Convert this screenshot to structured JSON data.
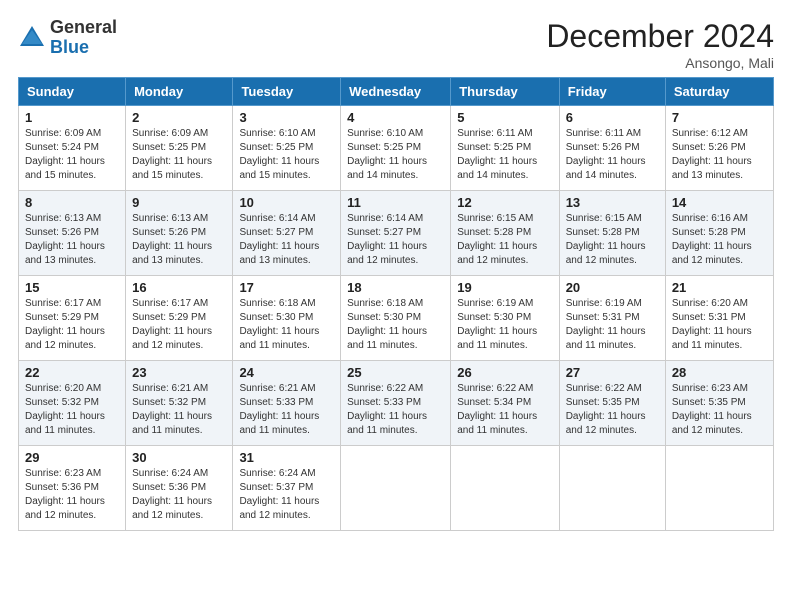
{
  "logo": {
    "general": "General",
    "blue": "Blue"
  },
  "title": "December 2024",
  "location": "Ansongo, Mali",
  "days_header": [
    "Sunday",
    "Monday",
    "Tuesday",
    "Wednesday",
    "Thursday",
    "Friday",
    "Saturday"
  ],
  "weeks": [
    [
      {
        "day": "1",
        "sunrise": "6:09 AM",
        "sunset": "5:24 PM",
        "daylight": "11 hours and 15 minutes."
      },
      {
        "day": "2",
        "sunrise": "6:09 AM",
        "sunset": "5:25 PM",
        "daylight": "11 hours and 15 minutes."
      },
      {
        "day": "3",
        "sunrise": "6:10 AM",
        "sunset": "5:25 PM",
        "daylight": "11 hours and 15 minutes."
      },
      {
        "day": "4",
        "sunrise": "6:10 AM",
        "sunset": "5:25 PM",
        "daylight": "11 hours and 14 minutes."
      },
      {
        "day": "5",
        "sunrise": "6:11 AM",
        "sunset": "5:25 PM",
        "daylight": "11 hours and 14 minutes."
      },
      {
        "day": "6",
        "sunrise": "6:11 AM",
        "sunset": "5:26 PM",
        "daylight": "11 hours and 14 minutes."
      },
      {
        "day": "7",
        "sunrise": "6:12 AM",
        "sunset": "5:26 PM",
        "daylight": "11 hours and 13 minutes."
      }
    ],
    [
      {
        "day": "8",
        "sunrise": "6:13 AM",
        "sunset": "5:26 PM",
        "daylight": "11 hours and 13 minutes."
      },
      {
        "day": "9",
        "sunrise": "6:13 AM",
        "sunset": "5:26 PM",
        "daylight": "11 hours and 13 minutes."
      },
      {
        "day": "10",
        "sunrise": "6:14 AM",
        "sunset": "5:27 PM",
        "daylight": "11 hours and 13 minutes."
      },
      {
        "day": "11",
        "sunrise": "6:14 AM",
        "sunset": "5:27 PM",
        "daylight": "11 hours and 12 minutes."
      },
      {
        "day": "12",
        "sunrise": "6:15 AM",
        "sunset": "5:28 PM",
        "daylight": "11 hours and 12 minutes."
      },
      {
        "day": "13",
        "sunrise": "6:15 AM",
        "sunset": "5:28 PM",
        "daylight": "11 hours and 12 minutes."
      },
      {
        "day": "14",
        "sunrise": "6:16 AM",
        "sunset": "5:28 PM",
        "daylight": "11 hours and 12 minutes."
      }
    ],
    [
      {
        "day": "15",
        "sunrise": "6:17 AM",
        "sunset": "5:29 PM",
        "daylight": "11 hours and 12 minutes."
      },
      {
        "day": "16",
        "sunrise": "6:17 AM",
        "sunset": "5:29 PM",
        "daylight": "11 hours and 12 minutes."
      },
      {
        "day": "17",
        "sunrise": "6:18 AM",
        "sunset": "5:30 PM",
        "daylight": "11 hours and 11 minutes."
      },
      {
        "day": "18",
        "sunrise": "6:18 AM",
        "sunset": "5:30 PM",
        "daylight": "11 hours and 11 minutes."
      },
      {
        "day": "19",
        "sunrise": "6:19 AM",
        "sunset": "5:30 PM",
        "daylight": "11 hours and 11 minutes."
      },
      {
        "day": "20",
        "sunrise": "6:19 AM",
        "sunset": "5:31 PM",
        "daylight": "11 hours and 11 minutes."
      },
      {
        "day": "21",
        "sunrise": "6:20 AM",
        "sunset": "5:31 PM",
        "daylight": "11 hours and 11 minutes."
      }
    ],
    [
      {
        "day": "22",
        "sunrise": "6:20 AM",
        "sunset": "5:32 PM",
        "daylight": "11 hours and 11 minutes."
      },
      {
        "day": "23",
        "sunrise": "6:21 AM",
        "sunset": "5:32 PM",
        "daylight": "11 hours and 11 minutes."
      },
      {
        "day": "24",
        "sunrise": "6:21 AM",
        "sunset": "5:33 PM",
        "daylight": "11 hours and 11 minutes."
      },
      {
        "day": "25",
        "sunrise": "6:22 AM",
        "sunset": "5:33 PM",
        "daylight": "11 hours and 11 minutes."
      },
      {
        "day": "26",
        "sunrise": "6:22 AM",
        "sunset": "5:34 PM",
        "daylight": "11 hours and 11 minutes."
      },
      {
        "day": "27",
        "sunrise": "6:22 AM",
        "sunset": "5:35 PM",
        "daylight": "11 hours and 12 minutes."
      },
      {
        "day": "28",
        "sunrise": "6:23 AM",
        "sunset": "5:35 PM",
        "daylight": "11 hours and 12 minutes."
      }
    ],
    [
      {
        "day": "29",
        "sunrise": "6:23 AM",
        "sunset": "5:36 PM",
        "daylight": "11 hours and 12 minutes."
      },
      {
        "day": "30",
        "sunrise": "6:24 AM",
        "sunset": "5:36 PM",
        "daylight": "11 hours and 12 minutes."
      },
      {
        "day": "31",
        "sunrise": "6:24 AM",
        "sunset": "5:37 PM",
        "daylight": "11 hours and 12 minutes."
      },
      null,
      null,
      null,
      null
    ]
  ]
}
